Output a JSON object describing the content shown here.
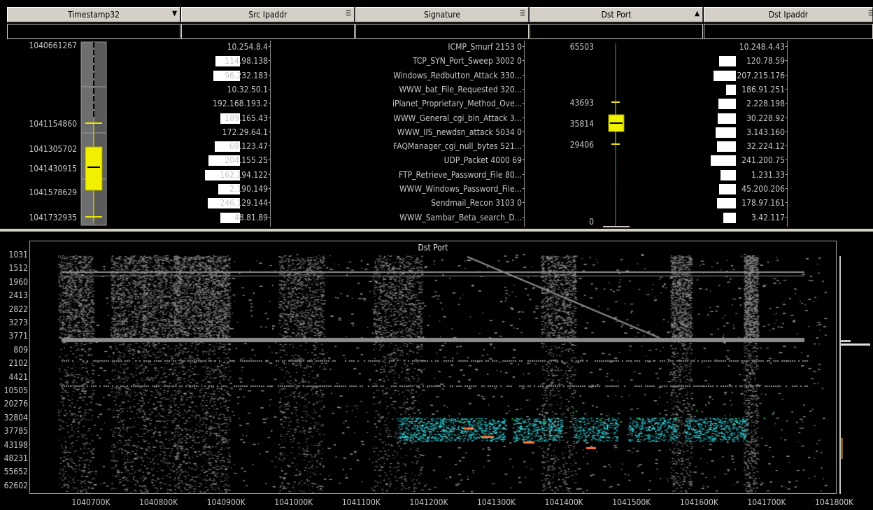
{
  "columns": [
    {
      "label": "Timestamp32",
      "icon": "sort-desc-icon"
    },
    {
      "label": "Src Ipaddr",
      "icon": "column-menu-icon"
    },
    {
      "label": "Signature",
      "icon": "column-menu-icon"
    },
    {
      "label": "Dst Port",
      "icon": "sort-asc-icon"
    },
    {
      "label": "Dst Ipaddr",
      "icon": "column-menu-icon"
    }
  ],
  "timestamp": {
    "ticks": [
      "1040661267",
      "1041154860",
      "1041305702",
      "1041430915",
      "1041578629",
      "1041732935"
    ]
  },
  "src_ipaddr": {
    "rows": [
      "10.254.8.4",
      "114.98.138",
      "96.232.183",
      "10.32.50.1",
      "192.168.193.2",
      "189.165.43",
      "172.29.64.1",
      "69.123.47",
      "204.155.25",
      "162.194.122",
      "2.190.149",
      "246.129.144",
      "48.81.89"
    ],
    "bar_fractions": [
      0,
      0.62,
      0.68,
      0,
      0,
      0.5,
      0,
      0.64,
      0.8,
      0.9,
      0.56,
      0.82,
      0.5
    ]
  },
  "signature": {
    "rows": [
      "ICMP_Smurf 2153 0",
      "TCP_SYN_Port_Sweep 3002 0",
      "Windows_Redbutton_Attack 330...",
      "WWW_bat_File_Requested 320...",
      "iPlanet_Proprietary_Method_Ove...",
      "WWW_General_cgi_bin_Attack 3...",
      "WWW_IIS_newdsn_attack 5034 0",
      "FAQManager_cgi_null_bytes 521...",
      "UDP_Packet 4000 69",
      "FTP_Retrieve_Password_File 80...",
      "WWW_Windows_Password_File...",
      "Sendmail_Recon 3103 0",
      "WWW_Sambar_Beta_search_D..."
    ]
  },
  "dst_port": {
    "ticks": [
      "65503",
      "43693",
      "35814",
      "29406",
      "0"
    ]
  },
  "dst_ipaddr": {
    "rows": [
      "10.248.4.43",
      "120.78.59",
      "207.215.176",
      "186.91.251",
      "2.228.198",
      "30.228.92",
      "3.143.160",
      "32.224.12",
      "241.200.75",
      "1.231.33",
      "45.200.206",
      "178.97.161",
      "3.42.117"
    ],
    "bar_fractions": [
      0,
      0.6,
      0.8,
      0.35,
      0.62,
      0.66,
      0.72,
      0.68,
      0.9,
      0.54,
      0.6,
      0.68,
      0.45
    ]
  },
  "scatter": {
    "title": "Dst Port",
    "y_labels": [
      "1031",
      "1512",
      "1960",
      "2413",
      "2822",
      "3273",
      "3771",
      "809",
      "2102",
      "4421",
      "10505",
      "20276",
      "32804",
      "37785",
      "43198",
      "48231",
      "55652",
      "62602"
    ],
    "x_labels": [
      "1040700K",
      "1040800K",
      "1040900K",
      "1041000K",
      "1041100K",
      "1041200K",
      "1041300K",
      "1041400K",
      "1041500K",
      "1041600K",
      "1041700K",
      "1041800K"
    ],
    "colors": {
      "background": "#000000",
      "points": "#8c8c8c",
      "highlight": "#33e0e8",
      "accent": "#ff7a3a"
    }
  }
}
